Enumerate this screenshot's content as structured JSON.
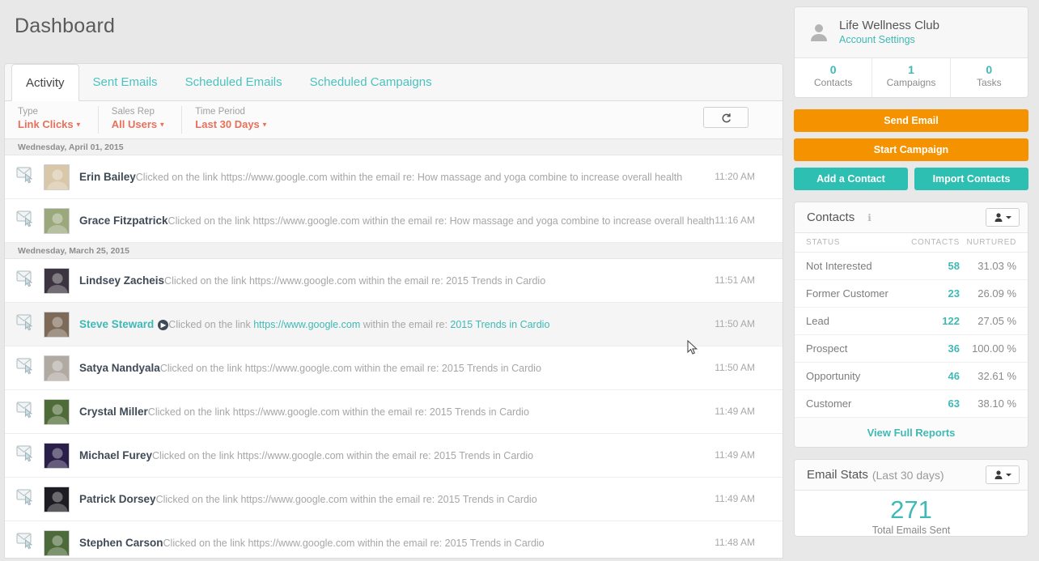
{
  "page_title": "Dashboard",
  "tabs": [
    {
      "label": "Activity",
      "active": true
    },
    {
      "label": "Sent Emails",
      "active": false
    },
    {
      "label": "Scheduled Emails",
      "active": false
    },
    {
      "label": "Scheduled Campaigns",
      "active": false
    }
  ],
  "filters": [
    {
      "label": "Type",
      "value": "Link Clicks"
    },
    {
      "label": "Sales Rep",
      "value": "All Users"
    },
    {
      "label": "Time Period",
      "value": "Last 30 Days"
    }
  ],
  "refresh_icon": "refresh-arrow-icon",
  "activity": {
    "groups": [
      {
        "date": "Wednesday, April 01, 2015",
        "rows": [
          {
            "name": "Erin Bailey",
            "prefix": "Clicked on the link ",
            "link": "https://www.google.com",
            "middle": " within the email re: ",
            "subject": "How massage and yoga combine to increase overall health",
            "time": "11:20 AM",
            "hover": false,
            "avatar": "#d8c7a8"
          },
          {
            "name": "Grace Fitzpatrick",
            "prefix": "Clicked on the link ",
            "link": "https://www.google.com",
            "middle": " within the email re: ",
            "subject": "How massage and yoga combine to increase overall health",
            "time": "11:16 AM",
            "hover": false,
            "avatar": "#9aa87c"
          }
        ]
      },
      {
        "date": "Wednesday, March 25, 2015",
        "rows": [
          {
            "name": "Lindsey Zacheis",
            "prefix": "Clicked on the link ",
            "link": "https://www.google.com",
            "middle": " within the email re: ",
            "subject": "2015 Trends in Cardio",
            "time": "11:51 AM",
            "hover": false,
            "avatar": "#3c3440"
          },
          {
            "name": "Steve Steward",
            "prefix": "Clicked on the link ",
            "link": "https://www.google.com",
            "middle": " within the email re: ",
            "subject": "2015 Trends in Cardio",
            "time": "11:50 AM",
            "hover": true,
            "badge": "▶",
            "avatar": "#7d6a58"
          },
          {
            "name": "Satya Nandyala",
            "prefix": "Clicked on the link ",
            "link": "https://www.google.com",
            "middle": " within the email re: ",
            "subject": "2015 Trends in Cardio",
            "time": "11:50 AM",
            "hover": false,
            "avatar": "#b0aaa2"
          },
          {
            "name": "Crystal Miller",
            "prefix": "Clicked on the link ",
            "link": "https://www.google.com",
            "middle": " within the email re: ",
            "subject": "2015 Trends in Cardio",
            "time": "11:49 AM",
            "hover": false,
            "avatar": "#4f6b37"
          },
          {
            "name": "Michael Furey",
            "prefix": "Clicked on the link ",
            "link": "https://www.google.com",
            "middle": " within the email re: ",
            "subject": "2015 Trends in Cardio",
            "time": "11:49 AM",
            "hover": false,
            "avatar": "#2a1f49"
          },
          {
            "name": "Patrick Dorsey",
            "prefix": "Clicked on the link ",
            "link": "https://www.google.com",
            "middle": " within the email re: ",
            "subject": "2015 Trends in Cardio",
            "time": "11:49 AM",
            "hover": false,
            "avatar": "#1c1c22"
          },
          {
            "name": "Stephen Carson",
            "prefix": "Clicked on the link ",
            "link": "https://www.google.com",
            "middle": " within the email re: ",
            "subject": "2015 Trends in Cardio",
            "time": "11:48 AM",
            "hover": false,
            "avatar": "#4d6a3a"
          }
        ]
      }
    ]
  },
  "sidebar": {
    "account": {
      "name": "Life Wellness Club",
      "settings_link": "Account Settings",
      "avatar_icon": "person-icon",
      "stats": [
        {
          "value": "0",
          "label": "Contacts"
        },
        {
          "value": "1",
          "label": "Campaigns"
        },
        {
          "value": "0",
          "label": "Tasks"
        }
      ]
    },
    "actions": {
      "send_email": "Send Email",
      "start_campaign": "Start Campaign",
      "add_contact": "Add a Contact",
      "import_contacts": "Import Contacts"
    },
    "contacts_panel": {
      "title": "Contacts",
      "info_icon": "info-icon",
      "menu_icon": "person-dropdown-icon",
      "columns": [
        "STATUS",
        "CONTACTS",
        "NURTURED"
      ],
      "rows": [
        {
          "status": "Not Interested",
          "contacts": "58",
          "nurtured": "31.03 %"
        },
        {
          "status": "Former Customer",
          "contacts": "23",
          "nurtured": "26.09 %"
        },
        {
          "status": "Lead",
          "contacts": "122",
          "nurtured": "27.05 %"
        },
        {
          "status": "Prospect",
          "contacts": "36",
          "nurtured": "100.00 %"
        },
        {
          "status": "Opportunity",
          "contacts": "46",
          "nurtured": "32.61 %"
        },
        {
          "status": "Customer",
          "contacts": "63",
          "nurtured": "38.10 %"
        }
      ],
      "footer_link": "View Full Reports"
    },
    "email_stats": {
      "title": "Email Stats",
      "subtitle": "(Last 30 days)",
      "menu_icon": "person-dropdown-icon",
      "total": "271",
      "total_label": "Total Emails Sent"
    }
  },
  "colors": {
    "teal": "#3fb9b5",
    "orange": "#f59200",
    "red_filter": "#e8705a"
  }
}
